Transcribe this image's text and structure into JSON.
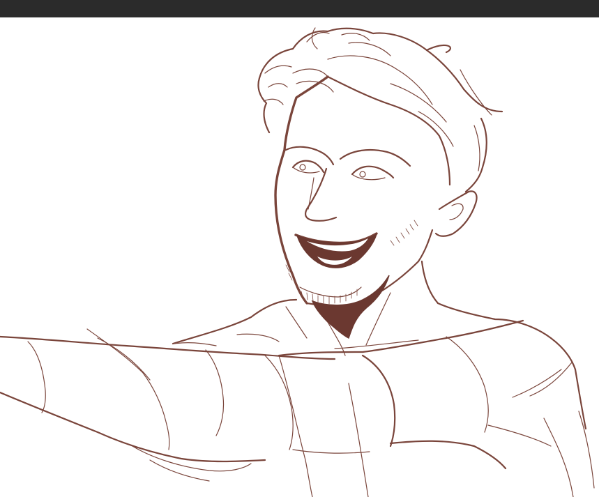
{
  "app": {
    "topbar_color": "#2b2b2b",
    "canvas_color": "#ffffff"
  },
  "artwork": {
    "ink_color": "#7a453b",
    "shadow_color": "#6b3830"
  }
}
